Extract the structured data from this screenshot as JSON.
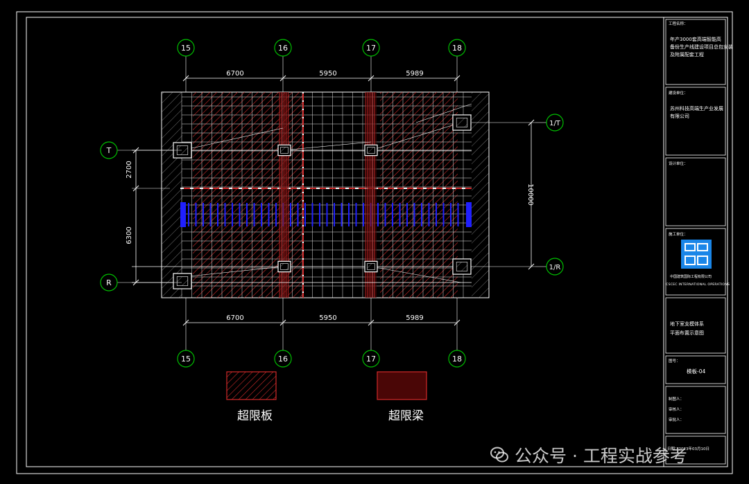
{
  "grid": {
    "columns": [
      "15",
      "16",
      "17",
      "18"
    ],
    "rows_left": [
      "T",
      "R"
    ],
    "rows_right": [
      "1/T",
      "1/R"
    ]
  },
  "dimensions": {
    "top_spans": [
      "6700",
      "5950",
      "5989"
    ],
    "bottom_spans": [
      "6700",
      "5950",
      "5989"
    ],
    "left_spans": [
      "2700",
      "6300"
    ],
    "right_span": "10000"
  },
  "legend": {
    "overlimit_slab": "超限板",
    "overlimit_beam": "超限梁"
  },
  "title_block": {
    "project_label": "工程名称：",
    "project_name": [
      "年产3000套高端智能高",
      "备份生产线建设项目总包安装",
      "及附属配套工程"
    ],
    "client_label": "建设单位：",
    "client_name": [
      "苏州科技高端生产业发展",
      "有限公司"
    ],
    "designer_label": "设计单位：",
    "contractor_label": "施工单位：",
    "contractor_name": "中国建筑国际工程有限公司",
    "contractor_name_en": "CSCEC INTERNATIONAL OPERATIONS",
    "drawing_title": [
      "地下室支模体系",
      "平面布置示意图"
    ],
    "drawing_no_label": "图号：",
    "drawing_no": "模板-04",
    "drawn_by_label": "制图人：",
    "checked_by_label": "审核人：",
    "approved_by_label": "审批人：",
    "date_text": "日期：2023年03月10日"
  },
  "watermark": {
    "text": "公众号 · 工程实战参考",
    "icon": "wechat-icon"
  },
  "colors": {
    "grid_bubble": "#00c000",
    "hatch_red": "#d12a2a",
    "beam_fill": "#4a0606",
    "frame": "#ffffff",
    "blue_band": "#2020ff",
    "logo_blue": "#1a86e8"
  }
}
